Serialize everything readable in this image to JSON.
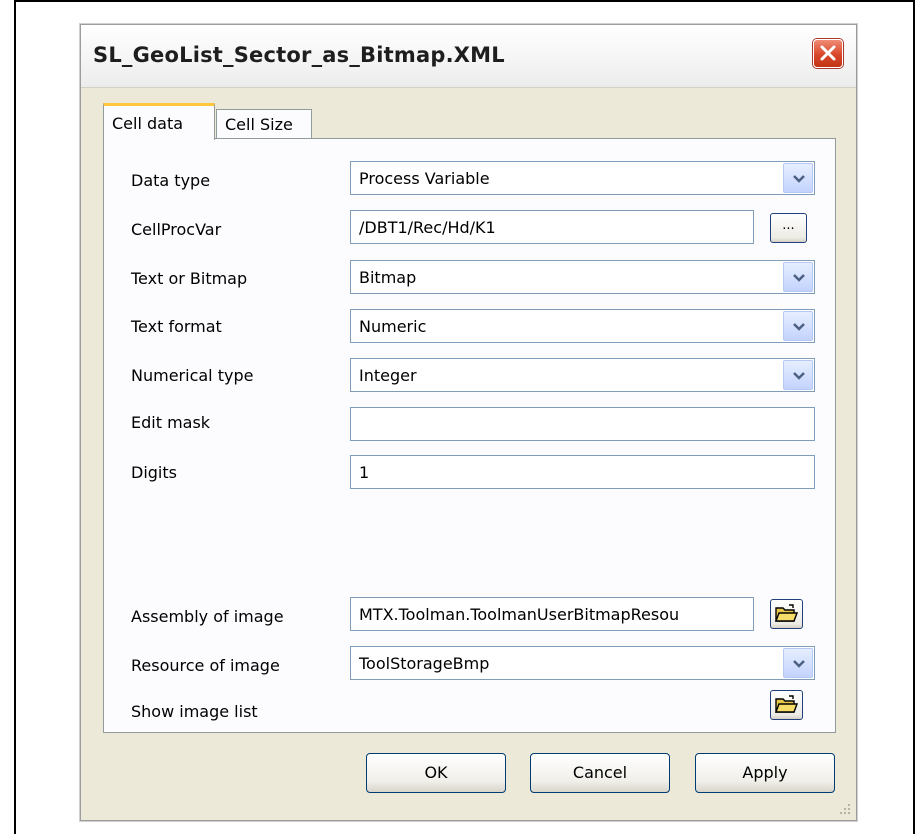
{
  "window": {
    "title": "SL_GeoList_Sector_as_Bitmap.XML"
  },
  "tabs": [
    {
      "label": "Cell data",
      "active": true
    },
    {
      "label": "Cell Size",
      "active": false
    }
  ],
  "form": {
    "data_type": {
      "label": "Data type",
      "value": "Process Variable"
    },
    "cell_proc_var": {
      "label": "CellProcVar",
      "value": "/DBT1/Rec/Hd/K1",
      "browse_label": "..."
    },
    "text_or_bitmap": {
      "label": "Text or Bitmap",
      "value": "Bitmap"
    },
    "text_format": {
      "label": "Text format",
      "value": "Numeric"
    },
    "numerical_type": {
      "label": "Numerical type",
      "value": "Integer"
    },
    "edit_mask": {
      "label": "Edit mask",
      "value": ""
    },
    "digits": {
      "label": "Digits",
      "value": "1"
    },
    "assembly_of_image": {
      "label": "Assembly of image",
      "value": "MTX.Toolman.ToolmanUserBitmapResou"
    },
    "resource_of_image": {
      "label": "Resource of image",
      "value": "ToolStorageBmp"
    },
    "show_image_list": {
      "label": "Show image list"
    }
  },
  "buttons": {
    "ok": "OK",
    "cancel": "Cancel",
    "apply": "Apply"
  },
  "colors": {
    "close_button": "#d9472b",
    "tab_highlight": "#ffc83c",
    "dialog_bg": "#ece9d8"
  }
}
